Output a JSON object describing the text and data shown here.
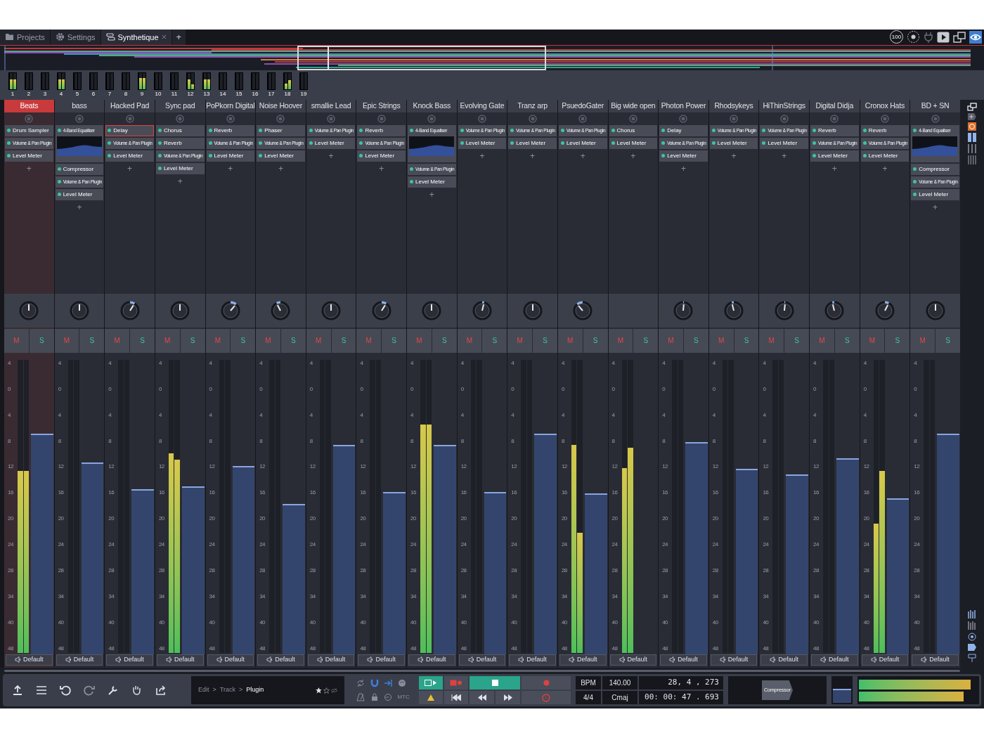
{
  "tabs": [
    {
      "label": "Projects",
      "selected": false
    },
    {
      "label": "Settings",
      "selected": false
    },
    {
      "label": "Synthetique",
      "selected": true
    }
  ],
  "new_tab": "+",
  "top_right": {
    "cpu": "100"
  },
  "meter_bridge": [
    {
      "label": "1",
      "meters": [
        {
          "level": 0.6
        },
        {
          "level": 0.6
        }
      ]
    },
    {
      "label": "2",
      "meters": [
        {
          "level": 0
        },
        {
          "level": 0
        }
      ]
    },
    {
      "label": "3",
      "meters": [
        {
          "level": 0
        },
        {
          "level": 0
        }
      ]
    },
    {
      "label": "4",
      "meters": [
        {
          "level": 0.6
        },
        {
          "level": 0.6
        }
      ]
    },
    {
      "label": "5",
      "meters": [
        {
          "level": 0
        },
        {
          "level": 0
        }
      ]
    },
    {
      "label": "6",
      "meters": [
        {
          "level": 0
        },
        {
          "level": 0
        }
      ]
    },
    {
      "label": "7",
      "meters": [
        {
          "level": 0
        },
        {
          "level": 0
        }
      ]
    },
    {
      "label": "8",
      "meters": [
        {
          "level": 0
        },
        {
          "level": 0
        }
      ]
    },
    {
      "label": "9",
      "meters": [
        {
          "level": 0.7
        },
        {
          "level": 0.7
        }
      ]
    },
    {
      "label": "10",
      "meters": [
        {
          "level": 0
        },
        {
          "level": 0
        }
      ]
    },
    {
      "label": "11",
      "meters": [
        {
          "level": 0
        },
        {
          "level": 0
        }
      ]
    },
    {
      "label": "12",
      "meters": [
        {
          "level": 0.6
        },
        {
          "level": 0.3
        }
      ]
    },
    {
      "label": "13",
      "meters": [
        {
          "level": 0.6
        },
        {
          "level": 0.6
        }
      ]
    },
    {
      "label": "14",
      "meters": [
        {
          "level": 0
        },
        {
          "level": 0
        }
      ]
    },
    {
      "label": "15",
      "meters": [
        {
          "level": 0
        },
        {
          "level": 0
        }
      ]
    },
    {
      "label": "16",
      "meters": [
        {
          "level": 0
        },
        {
          "level": 0
        }
      ]
    },
    {
      "label": "17",
      "meters": [
        {
          "level": 0
        },
        {
          "level": 0
        }
      ]
    },
    {
      "label": "18",
      "meters": [
        {
          "level": 0.35
        },
        {
          "level": 0.55
        }
      ]
    },
    {
      "label": "19",
      "meters": [
        {
          "level": 0
        },
        {
          "level": 0
        }
      ]
    }
  ],
  "tracks": [
    {
      "name": "Beats",
      "selected": true,
      "plugins": [
        {
          "name": "Drum Sampler",
          "kind": "plugin",
          "selected": false
        },
        {
          "name": "Volume & Pan Plugin",
          "kind": "plugin",
          "selected": false
        },
        {
          "name": "Level Meter",
          "kind": "plugin",
          "selected": false
        }
      ],
      "add": "+",
      "pan": {
        "level": 0.5
      },
      "mute": "M",
      "solo": "S",
      "scale": [
        "4",
        "0",
        "4",
        "8",
        "12",
        "16",
        "20",
        "24",
        "28",
        "34",
        "40",
        "48"
      ],
      "meters": [
        {
          "level": 0.62
        },
        {
          "level": 0.62
        }
      ],
      "fader": {
        "level": 0.75
      },
      "output": "Default"
    },
    {
      "name": "bass",
      "selected": false,
      "plugins": [
        {
          "name": "4-Band Equaliser",
          "kind": "eq",
          "selected": false
        },
        {
          "name": "Compressor",
          "kind": "plugin",
          "selected": false
        },
        {
          "name": "Volume & Pan Plugin",
          "kind": "plugin",
          "selected": false
        },
        {
          "name": "Level Meter",
          "kind": "plugin",
          "selected": false
        }
      ],
      "add": "+",
      "pan": {
        "level": 0.5
      },
      "mute": "M",
      "solo": "S",
      "scale": [
        "4",
        "0",
        "4",
        "8",
        "12",
        "16",
        "20",
        "24",
        "28",
        "34",
        "40",
        "48"
      ],
      "meters": [
        {
          "level": 0
        },
        {
          "level": 0
        }
      ],
      "fader": {
        "level": 0.65
      },
      "output": "Default"
    },
    {
      "name": "Hacked Pad",
      "selected": false,
      "plugins": [
        {
          "name": "Delay",
          "kind": "plugin",
          "selected": true
        },
        {
          "name": "Volume & Pan Plugin",
          "kind": "plugin",
          "selected": false
        },
        {
          "name": "Level Meter",
          "kind": "plugin",
          "selected": false
        }
      ],
      "add": "+",
      "pan": {
        "level": 0.62
      },
      "mute": "M",
      "solo": "S",
      "scale": [
        "4",
        "0",
        "4",
        "8",
        "12",
        "16",
        "20",
        "24",
        "28",
        "34",
        "40",
        "48"
      ],
      "meters": [
        {
          "level": 0
        },
        {
          "level": 0
        }
      ],
      "fader": {
        "level": 0.56
      },
      "output": "Default"
    },
    {
      "name": "Sync pad",
      "selected": false,
      "plugins": [
        {
          "name": "Chorus",
          "kind": "plugin",
          "selected": false
        },
        {
          "name": "Reverb",
          "kind": "plugin",
          "selected": false
        },
        {
          "name": "Volume & Pan Plugin",
          "kind": "plugin",
          "selected": false
        },
        {
          "name": "Level Meter",
          "kind": "plugin",
          "selected": false
        }
      ],
      "add": "+",
      "pan": {
        "level": 0.5
      },
      "mute": "M",
      "solo": "S",
      "scale": [
        "4",
        "0",
        "4",
        "8",
        "12",
        "16",
        "20",
        "24",
        "28",
        "34",
        "40",
        "48"
      ],
      "meters": [
        {
          "level": 0.68
        },
        {
          "level": 0.66
        }
      ],
      "fader": {
        "level": 0.57
      },
      "output": "Default"
    },
    {
      "name": "PoPkorn Digital",
      "selected": false,
      "plugins": [
        {
          "name": "Reverb",
          "kind": "plugin",
          "selected": false
        },
        {
          "name": "Volume & Pan Plugin",
          "kind": "plugin",
          "selected": false
        },
        {
          "name": "Level Meter",
          "kind": "plugin",
          "selected": false
        }
      ],
      "add": "+",
      "pan": {
        "level": 0.65
      },
      "mute": "M",
      "solo": "S",
      "scale": [
        "4",
        "0",
        "4",
        "8",
        "12",
        "16",
        "20",
        "24",
        "28",
        "34",
        "40",
        "48"
      ],
      "meters": [
        {
          "level": 0
        },
        {
          "level": 0
        }
      ],
      "fader": {
        "level": 0.64
      },
      "output": "Default"
    },
    {
      "name": "Noise Hoover",
      "selected": false,
      "plugins": [
        {
          "name": "Phaser",
          "kind": "plugin",
          "selected": false
        },
        {
          "name": "Volume & Pan Plugin",
          "kind": "plugin",
          "selected": false
        },
        {
          "name": "Level Meter",
          "kind": "plugin",
          "selected": false
        }
      ],
      "add": "+",
      "pan": {
        "level": 0.4
      },
      "mute": "M",
      "solo": "S",
      "scale": [
        "4",
        "0",
        "4",
        "8",
        "12",
        "16",
        "20",
        "24",
        "28",
        "34",
        "40",
        "48"
      ],
      "meters": [
        {
          "level": 0
        },
        {
          "level": 0
        }
      ],
      "fader": {
        "level": 0.51
      },
      "output": "Default"
    },
    {
      "name": "smallie Lead",
      "selected": false,
      "plugins": [
        {
          "name": "Volume & Pan Plugin",
          "kind": "plugin",
          "selected": false
        },
        {
          "name": "Level Meter",
          "kind": "plugin",
          "selected": false
        }
      ],
      "add": "+",
      "pan": {
        "level": 0.5
      },
      "mute": "M",
      "solo": "S",
      "scale": [
        "4",
        "0",
        "4",
        "8",
        "12",
        "16",
        "20",
        "24",
        "28",
        "34",
        "40",
        "48"
      ],
      "meters": [
        {
          "level": 0
        },
        {
          "level": 0
        }
      ],
      "fader": {
        "level": 0.71
      },
      "output": "Default"
    },
    {
      "name": "Epic Strings",
      "selected": false,
      "plugins": [
        {
          "name": "Reverb",
          "kind": "plugin",
          "selected": false
        },
        {
          "name": "Volume & Pan Plugin",
          "kind": "plugin",
          "selected": false
        },
        {
          "name": "Level Meter",
          "kind": "plugin",
          "selected": false
        }
      ],
      "add": "+",
      "pan": {
        "level": 0.62
      },
      "mute": "M",
      "solo": "S",
      "scale": [
        "4",
        "0",
        "4",
        "8",
        "12",
        "16",
        "20",
        "24",
        "28",
        "34",
        "40",
        "48"
      ],
      "meters": [
        {
          "level": 0
        },
        {
          "level": 0
        }
      ],
      "fader": {
        "level": 0.55
      },
      "output": "Default"
    },
    {
      "name": "Knock Bass",
      "selected": false,
      "plugins": [
        {
          "name": "4-Band Equaliser",
          "kind": "eq",
          "selected": false
        },
        {
          "name": "Volume & Pan Plugin",
          "kind": "plugin",
          "selected": false
        },
        {
          "name": "Level Meter",
          "kind": "plugin",
          "selected": false
        }
      ],
      "add": "+",
      "pan": {
        "level": 0.5
      },
      "mute": "M",
      "solo": "S",
      "scale": [
        "4",
        "0",
        "4",
        "8",
        "12",
        "16",
        "20",
        "24",
        "28",
        "34",
        "40",
        "48"
      ],
      "meters": [
        {
          "level": 0.78
        },
        {
          "level": 0.78
        }
      ],
      "fader": {
        "level": 0.71
      },
      "output": "Default"
    },
    {
      "name": "Evolving Gate",
      "selected": false,
      "plugins": [
        {
          "name": "Volume & Pan Plugin",
          "kind": "plugin",
          "selected": false
        },
        {
          "name": "Level Meter",
          "kind": "plugin",
          "selected": false
        }
      ],
      "add": "+",
      "pan": {
        "level": 0.55
      },
      "mute": "M",
      "solo": "S",
      "scale": [
        "4",
        "0",
        "4",
        "8",
        "12",
        "16",
        "20",
        "24",
        "28",
        "34",
        "40",
        "48"
      ],
      "meters": [
        {
          "level": 0
        },
        {
          "level": 0
        }
      ],
      "fader": {
        "level": 0.55
      },
      "output": "Default"
    },
    {
      "name": "Tranz arp",
      "selected": false,
      "plugins": [
        {
          "name": "Volume & Pan Plugin",
          "kind": "plugin",
          "selected": false
        },
        {
          "name": "Level Meter",
          "kind": "plugin",
          "selected": false
        }
      ],
      "add": "+",
      "pan": {
        "level": 0.5
      },
      "mute": "M",
      "solo": "S",
      "scale": [
        "4",
        "0",
        "4",
        "8",
        "12",
        "16",
        "20",
        "24",
        "28",
        "34",
        "40",
        "48"
      ],
      "meters": [
        {
          "level": 0
        },
        {
          "level": 0
        }
      ],
      "fader": {
        "level": 0.75
      },
      "output": "Default"
    },
    {
      "name": "PsuedoGater",
      "selected": false,
      "plugins": [
        {
          "name": "Volume & Pan Plugin",
          "kind": "plugin",
          "selected": false
        },
        {
          "name": "Level Meter",
          "kind": "plugin",
          "selected": false
        }
      ],
      "add": "+",
      "pan": {
        "level": 0.35
      },
      "mute": "M",
      "solo": "S",
      "scale": [
        "4",
        "0",
        "4",
        "8",
        "12",
        "16",
        "20",
        "24",
        "28",
        "34",
        "40",
        "48"
      ],
      "meters": [
        {
          "level": 0.71
        },
        {
          "level": 0.41
        }
      ],
      "fader": {
        "level": 0.545
      },
      "output": "Default"
    },
    {
      "name": "Big wide open",
      "selected": false,
      "plugins": [
        {
          "name": "Chorus",
          "kind": "plugin",
          "selected": false
        },
        {
          "name": "Level Meter",
          "kind": "plugin",
          "selected": false
        }
      ],
      "add": "+",
      "mute": "M",
      "solo": "S",
      "scale": [
        "4",
        "0",
        "4",
        "8",
        "12",
        "16",
        "20",
        "24",
        "28",
        "34",
        "40",
        "48"
      ],
      "meters": [
        {
          "level": 0.63
        },
        {
          "level": 0.7
        }
      ],
      "output": "Default"
    },
    {
      "name": "Photon Power",
      "selected": false,
      "plugins": [
        {
          "name": "Delay",
          "kind": "plugin",
          "selected": false
        },
        {
          "name": "Volume & Pan Plugin",
          "kind": "plugin",
          "selected": false
        },
        {
          "name": "Level Meter",
          "kind": "plugin",
          "selected": false
        }
      ],
      "add": "+",
      "pan": {
        "level": 0.52
      },
      "mute": "M",
      "solo": "S",
      "scale": [
        "4",
        "0",
        "4",
        "8",
        "12",
        "16",
        "20",
        "24",
        "28",
        "34",
        "40",
        "48"
      ],
      "meters": [
        {
          "level": 0
        },
        {
          "level": 0
        }
      ],
      "fader": {
        "level": 0.72
      },
      "output": "Default"
    },
    {
      "name": "Rhodsykeys",
      "selected": false,
      "plugins": [
        {
          "name": "Volume & Pan Plugin",
          "kind": "plugin",
          "selected": false
        },
        {
          "name": "Level Meter",
          "kind": "plugin",
          "selected": false
        }
      ],
      "add": "+",
      "pan": {
        "level": 0.45
      },
      "mute": "M",
      "solo": "S",
      "scale": [
        "4",
        "0",
        "4",
        "8",
        "12",
        "16",
        "20",
        "24",
        "28",
        "34",
        "40",
        "48"
      ],
      "meters": [
        {
          "level": 0
        },
        {
          "level": 0
        }
      ],
      "fader": {
        "level": 0.63
      },
      "output": "Default"
    },
    {
      "name": "HiThinStrings",
      "selected": false,
      "plugins": [
        {
          "name": "Volume & Pan Plugin",
          "kind": "plugin",
          "selected": false
        },
        {
          "name": "Level Meter",
          "kind": "plugin",
          "selected": false
        }
      ],
      "add": "+",
      "pan": {
        "level": 0.52
      },
      "mute": "M",
      "solo": "S",
      "scale": [
        "4",
        "0",
        "4",
        "8",
        "12",
        "16",
        "20",
        "24",
        "28",
        "34",
        "40",
        "48"
      ],
      "meters": [
        {
          "level": 0
        },
        {
          "level": 0
        }
      ],
      "fader": {
        "level": 0.61
      },
      "output": "Default"
    },
    {
      "name": "Digital Didja",
      "selected": false,
      "plugins": [
        {
          "name": "Reverb",
          "kind": "plugin",
          "selected": false
        },
        {
          "name": "Volume & Pan Plugin",
          "kind": "plugin",
          "selected": false
        },
        {
          "name": "Level Meter",
          "kind": "plugin",
          "selected": false
        }
      ],
      "add": "+",
      "pan": {
        "level": 0.45
      },
      "mute": "M",
      "solo": "S",
      "scale": [
        "4",
        "0",
        "4",
        "8",
        "12",
        "16",
        "20",
        "24",
        "28",
        "34",
        "40",
        "48"
      ],
      "meters": [
        {
          "level": 0
        },
        {
          "level": 0
        }
      ],
      "fader": {
        "level": 0.665
      },
      "output": "Default"
    },
    {
      "name": "Cronox Hats",
      "selected": false,
      "plugins": [
        {
          "name": "Reverb",
          "kind": "plugin",
          "selected": false
        },
        {
          "name": "Volume & Pan Plugin",
          "kind": "plugin",
          "selected": false
        },
        {
          "name": "Level Meter",
          "kind": "plugin",
          "selected": false
        }
      ],
      "add": "+",
      "pan": {
        "level": 0.6
      },
      "mute": "M",
      "solo": "S",
      "scale": [
        "4",
        "0",
        "4",
        "8",
        "12",
        "16",
        "20",
        "24",
        "28",
        "34",
        "40",
        "48"
      ],
      "meters": [
        {
          "level": 0.44
        },
        {
          "level": 0.62
        }
      ],
      "fader": {
        "level": 0.53
      },
      "output": "Default"
    },
    {
      "name": "BD + SN",
      "selected": false,
      "plugins": [
        {
          "name": "4-Band Equaliser",
          "kind": "eq",
          "selected": false
        },
        {
          "name": "Compressor",
          "kind": "plugin",
          "selected": false
        },
        {
          "name": "Volume & Pan Plugin",
          "kind": "plugin",
          "selected": false
        },
        {
          "name": "Level Meter",
          "kind": "plugin",
          "selected": false
        }
      ],
      "add": "+",
      "pan": {
        "level": 0.5
      },
      "mute": "M",
      "solo": "S",
      "scale": [
        "4",
        "0",
        "4",
        "8",
        "12",
        "16",
        "20",
        "24",
        "28",
        "34",
        "40",
        "48"
      ],
      "meters": [
        {
          "level": 0
        },
        {
          "level": 0
        }
      ],
      "fader": {
        "level": 0.75
      },
      "output": "Default"
    }
  ],
  "breadcrumb": [
    "Edit",
    ">",
    "Track",
    ">",
    "Plugin"
  ],
  "sync": {
    "mtc": "MTC"
  },
  "tempo": {
    "bpm_label": "BPM",
    "bpm": "140.00",
    "time_signature": "4/4",
    "key": "Cmaj",
    "position": "28, 4 , 273",
    "time": "00: 00: 47 . 693"
  },
  "plugin_display": "Compressor",
  "master": {
    "fader": {
      "level": 0.55
    },
    "meters": [
      {
        "level": 0.94
      },
      {
        "level": 0.88
      }
    ]
  }
}
